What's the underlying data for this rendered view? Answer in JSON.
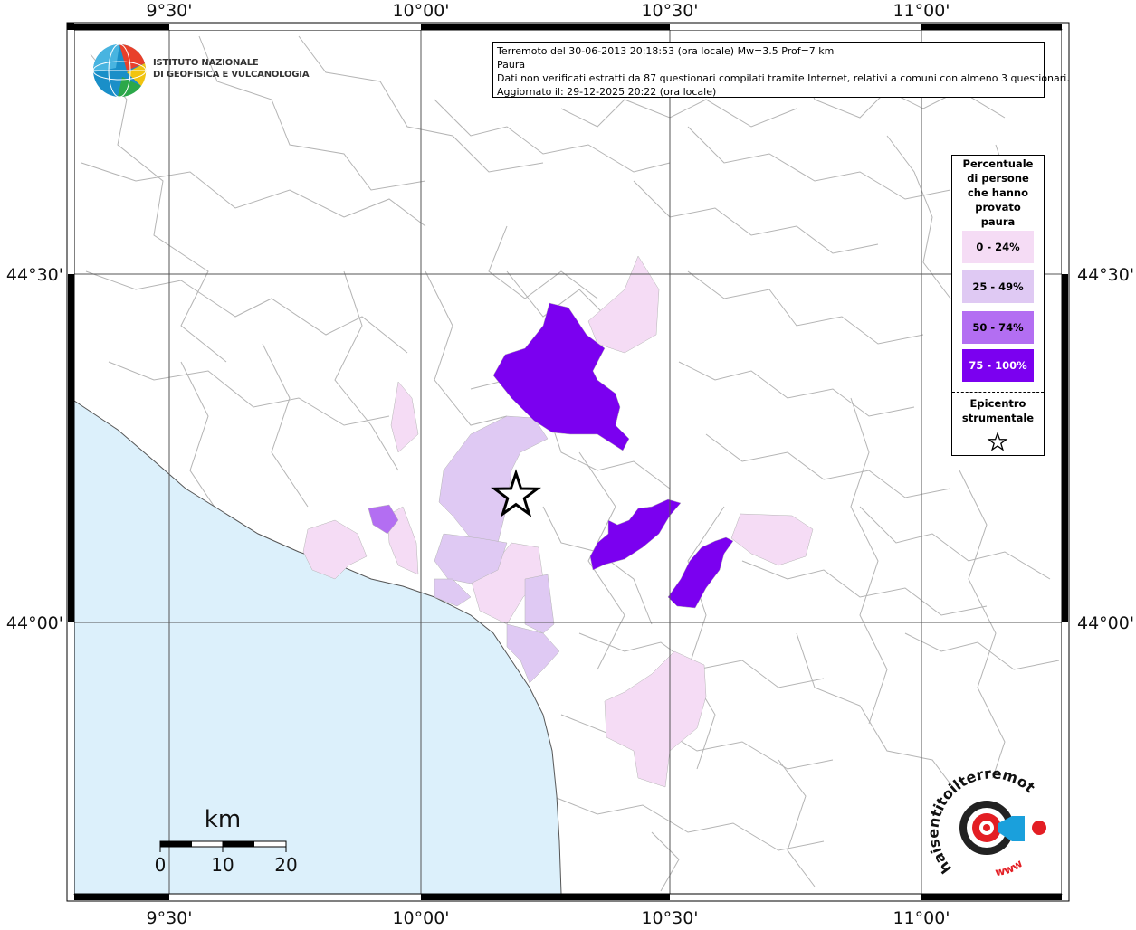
{
  "map": {
    "top_ticks": [
      "9°30'",
      "10°00'",
      "10°30'",
      "11°00'"
    ],
    "bottom_ticks": [
      "9°30'",
      "10°00'",
      "10°30'",
      "11°00'"
    ],
    "left_ticks": [
      "44°30'",
      "44°00'"
    ],
    "right_ticks": [
      "44°30'",
      "44°00'"
    ]
  },
  "info": {
    "line1": "Terremoto del 30-06-2013 20:18:53 (ora locale) Mw=3.5 Prof=7 km",
    "line2": "Paura",
    "line3": "Dati non verificati estratti da 87 questionari compilati tramite Internet, relativi a comuni con almeno 3 questionari.",
    "line4": "Aggiornato il: 29-12-2025 20:22 (ora locale)"
  },
  "logo": {
    "line1": "ISTITUTO NAZIONALE",
    "line2": "DI GEOFISICA E VULCANOLOGIA"
  },
  "legend": {
    "title_lines": [
      "Percentuale",
      "di persone",
      "che hanno",
      "provato",
      "paura"
    ],
    "classes": [
      {
        "label": "0 - 24%",
        "color": "#f5dcf5"
      },
      {
        "label": "25 - 49%",
        "color": "#dfc9f3"
      },
      {
        "label": "50 - 74%",
        "color": "#b36ef2"
      },
      {
        "label": "75 - 100%",
        "color": "#7b00f0"
      }
    ],
    "epicenter_lines": [
      "Epicentro",
      "strumentale"
    ]
  },
  "scale": {
    "unit": "km",
    "labels": [
      "0",
      "10",
      "20"
    ]
  },
  "badge": {
    "text_top": "haisentitoilterremoto.it",
    "text_bottom": "www"
  },
  "colors": {
    "sea": "#dcf0fb",
    "land": "#ffffff",
    "borders": "#b4b4b4",
    "grid": "#555555"
  }
}
